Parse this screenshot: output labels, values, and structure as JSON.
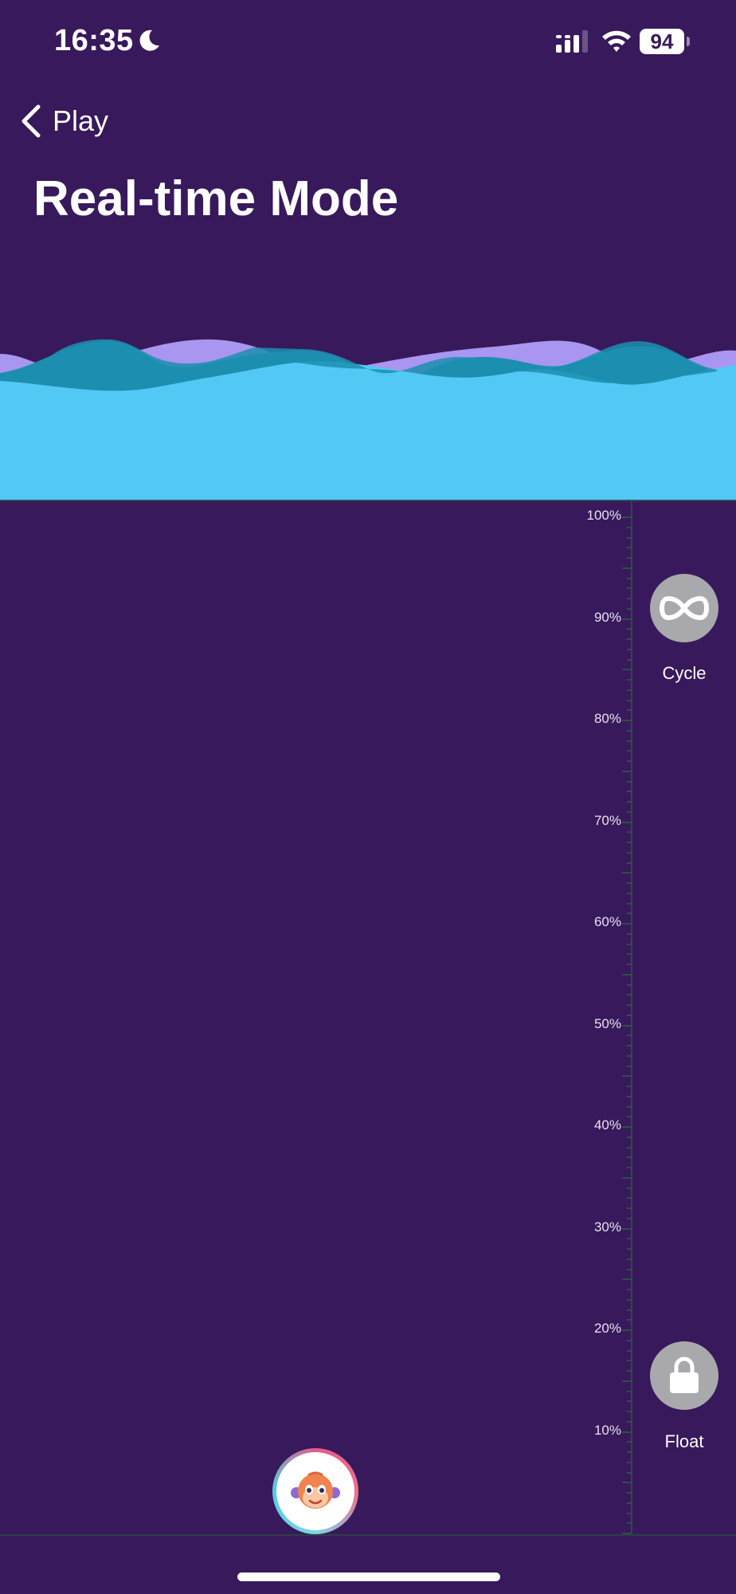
{
  "status_bar": {
    "time": "16:35",
    "battery": "94",
    "icons": [
      "moon-icon",
      "signal-icon",
      "wifi-icon",
      "battery-icon"
    ]
  },
  "nav": {
    "back_label": "Play",
    "back_icon": "chevron-left-icon"
  },
  "page": {
    "title": "Real-time Mode"
  },
  "scale": {
    "labels": [
      "100%",
      "90%",
      "80%",
      "70%",
      "60%",
      "50%",
      "40%",
      "30%",
      "20%",
      "10%"
    ]
  },
  "controls": {
    "cycle": {
      "label": "Cycle",
      "icon": "infinity-icon"
    },
    "float": {
      "label": "Float",
      "icon": "lock-icon"
    }
  },
  "avatar": {
    "icon": "monkey-avatar-icon"
  },
  "colors": {
    "background": "#38195b",
    "wave_front": "#52c8f5",
    "wave_mid": "#1c8fb0",
    "wave_back": "#a996f0",
    "button_gray": "#a9a9ad"
  }
}
